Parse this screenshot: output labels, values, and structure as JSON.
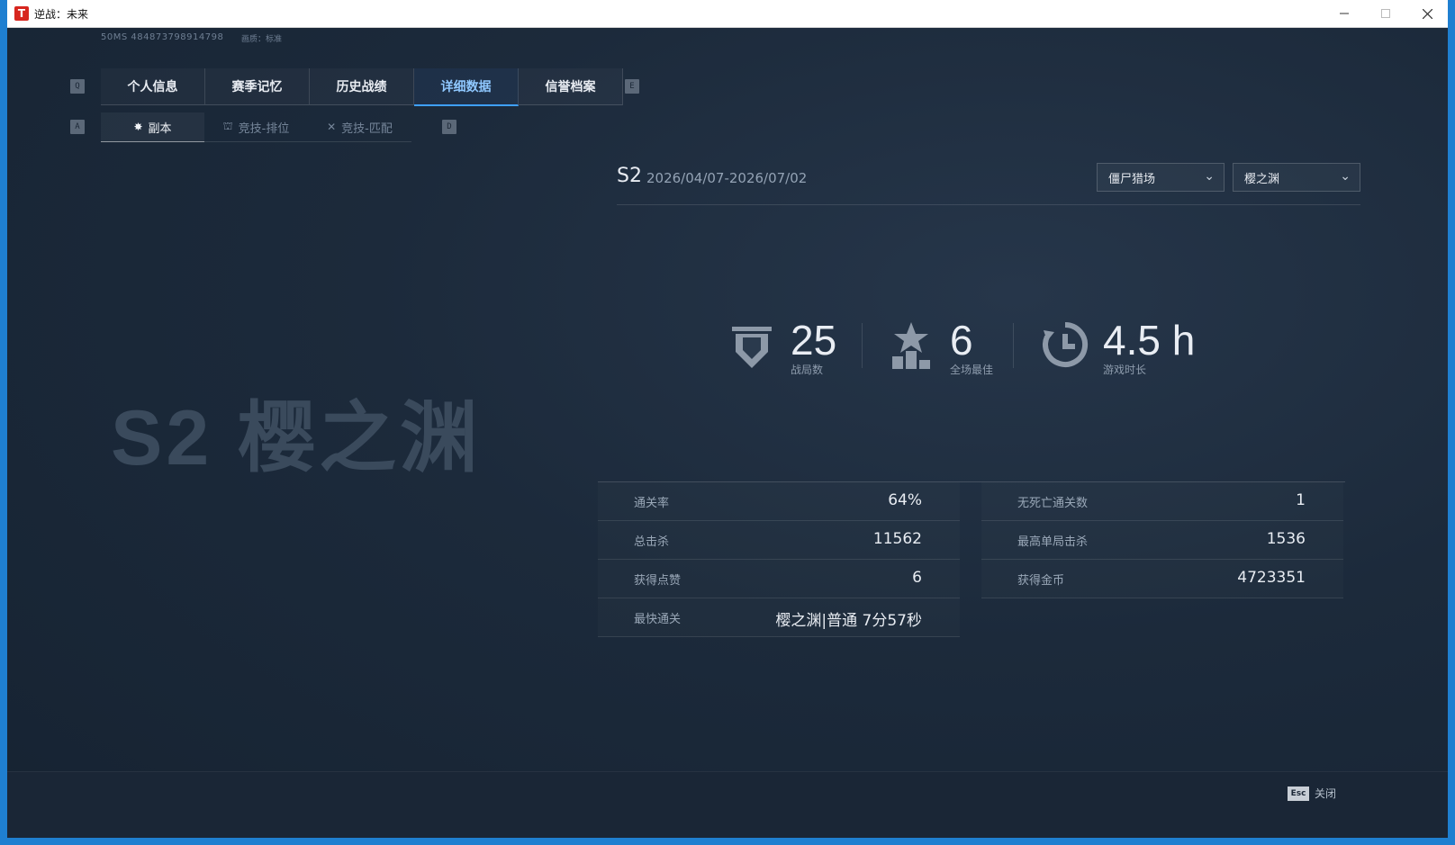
{
  "window": {
    "title": "逆战：未来",
    "app_logo_glyph": "T",
    "minimize_icon": "minimize-icon",
    "maximize_icon": "maximize-icon",
    "close_icon": "close-icon"
  },
  "status": {
    "ping": "50MS 484873798914798",
    "quality": "画质：标准"
  },
  "nav": {
    "key_left": "Q",
    "key_right": "E",
    "tabs": [
      "个人信息",
      "赛季记忆",
      "历史战绩",
      "详细数据",
      "信誉档案"
    ],
    "active_tab": "详细数据"
  },
  "subnav": {
    "key_left": "A",
    "key_right": "D",
    "tabs": [
      "副本",
      "竞技-排位",
      "竞技-匹配"
    ],
    "active_tab": "副本"
  },
  "watermark": "S2 樱之渊",
  "season": {
    "code": "S2",
    "range": "2026/04/07-2026/07/02",
    "mode_dropdown": "僵尸猎场",
    "map_dropdown": "樱之渊"
  },
  "summary": {
    "matches": {
      "value": "25",
      "label": "战局数",
      "icon": "shield-icon"
    },
    "mvp": {
      "value": "6",
      "label": "全场最佳",
      "icon": "podium-star-icon"
    },
    "playtime": {
      "value": "4.5 h",
      "label": "游戏时长",
      "icon": "clock-icon"
    }
  },
  "details": {
    "left": [
      {
        "label": "通关率",
        "value": "64%"
      },
      {
        "label": "总击杀",
        "value": "11562"
      },
      {
        "label": "获得点赞",
        "value": "6"
      },
      {
        "label": "最快通关",
        "value": "樱之渊|普通 7分57秒"
      }
    ],
    "right": [
      {
        "label": "无死亡通关数",
        "value": "1"
      },
      {
        "label": "最高单局击杀",
        "value": "1536"
      },
      {
        "label": "获得金币",
        "value": "4723351"
      }
    ]
  },
  "footer": {
    "esc_key": "Esc",
    "close_label": "关闭"
  },
  "colors": {
    "accent": "#3fa0ff",
    "background": "#1c2a3b",
    "desktop": "#1f7fd0"
  }
}
